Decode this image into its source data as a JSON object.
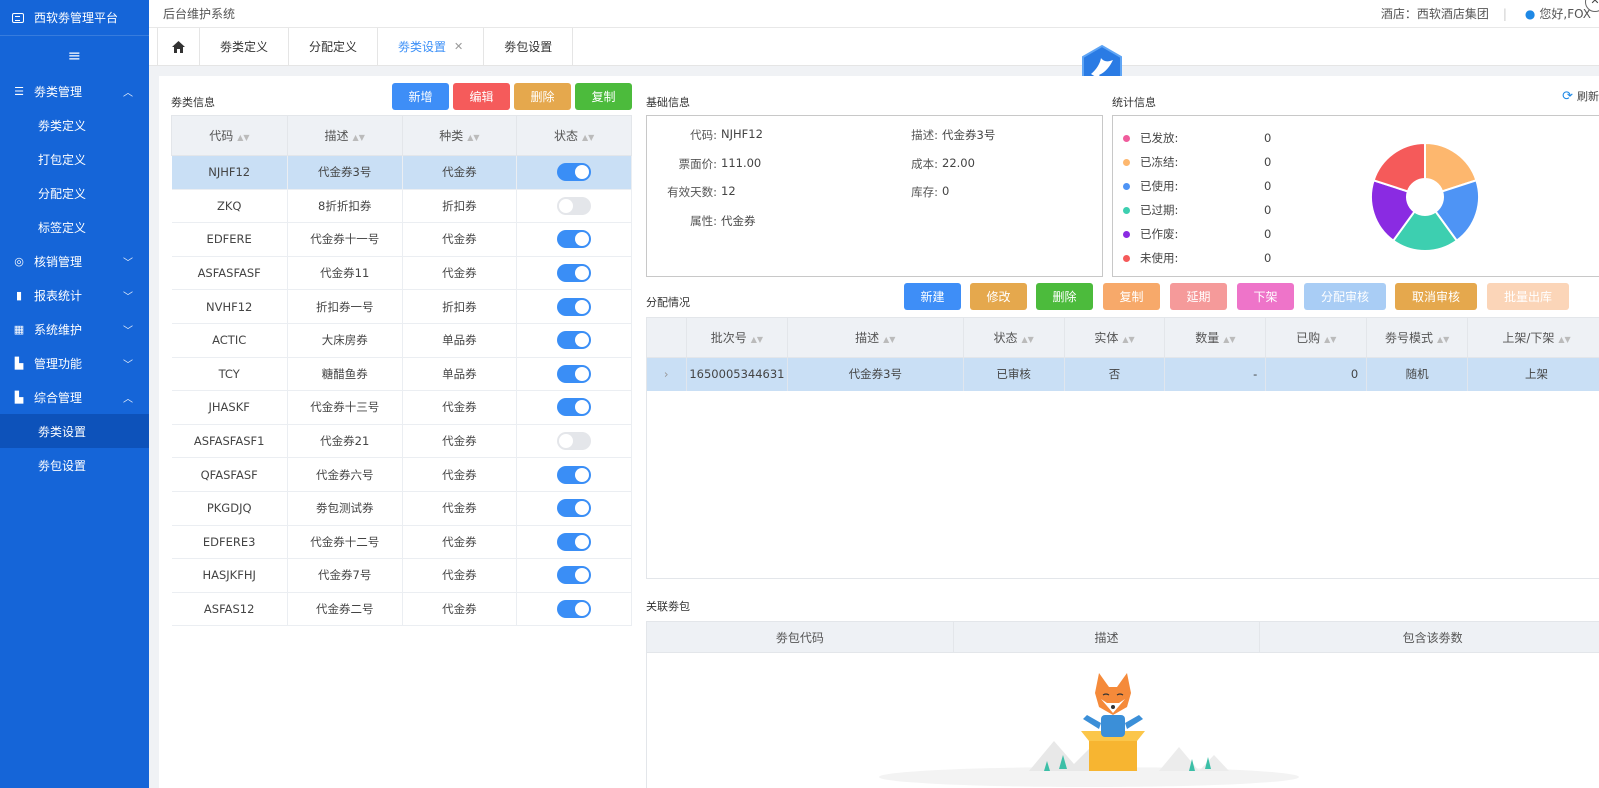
{
  "app": {
    "brand": "西软劵管理平台",
    "system_title": "后台维护系统",
    "hotel": "酒店：西软酒店集团",
    "separator": "|",
    "user": "您好,FOX"
  },
  "sidebar": {
    "collapse_icon": "≡",
    "menus": [
      {
        "label": "劵类管理",
        "icon": "list-icon",
        "expanded": true,
        "children": [
          "劵类定义",
          "打包定义",
          "分配定义",
          "标签定义"
        ]
      },
      {
        "label": "核销管理",
        "icon": "check-icon",
        "expanded": false,
        "children": []
      },
      {
        "label": "报表统计",
        "icon": "chart-icon",
        "expanded": false,
        "children": []
      },
      {
        "label": "系统维护",
        "icon": "grid-icon",
        "expanded": false,
        "children": []
      },
      {
        "label": "管理功能",
        "icon": "manage-icon",
        "expanded": false,
        "children": []
      },
      {
        "label": "综合管理",
        "icon": "manage-icon",
        "expanded": true,
        "children": [
          "劵类设置",
          "劵包设置"
        ]
      }
    ],
    "active_item": "劵类设置"
  },
  "tabs": [
    {
      "label": "劵类定义",
      "active": false
    },
    {
      "label": "分配定义",
      "active": false
    },
    {
      "label": "劵类设置",
      "active": true
    },
    {
      "label": "劵包设置",
      "active": false
    }
  ],
  "coupon_info": {
    "title": "劵类信息",
    "buttons": {
      "add": "新增",
      "edit": "编辑",
      "delete": "删除",
      "copy": "复制"
    },
    "columns": [
      "代码",
      "描述",
      "种类",
      "状态"
    ],
    "rows": [
      {
        "code": "NJHF12",
        "desc": "代金券3号",
        "kind": "代金券",
        "status": true,
        "selected": true
      },
      {
        "code": "ZKQ",
        "desc": "8折折扣券",
        "kind": "折扣券",
        "status": false
      },
      {
        "code": "EDFERE",
        "desc": "代金券十一号",
        "kind": "代金券",
        "status": true
      },
      {
        "code": "ASFASFASF",
        "desc": "代金券11",
        "kind": "代金券",
        "status": true
      },
      {
        "code": "NVHF12",
        "desc": "折扣券一号",
        "kind": "折扣券",
        "status": true
      },
      {
        "code": "ACTIC",
        "desc": "大床房券",
        "kind": "单品券",
        "status": true
      },
      {
        "code": "TCY",
        "desc": "糖醋鱼券",
        "kind": "单品券",
        "status": true
      },
      {
        "code": "JHASKF",
        "desc": "代金券十三号",
        "kind": "代金券",
        "status": true
      },
      {
        "code": "ASFASFASF1",
        "desc": "代金券21",
        "kind": "代金券",
        "status": false
      },
      {
        "code": "QFASFASF",
        "desc": "代金券六号",
        "kind": "代金券",
        "status": true
      },
      {
        "code": "PKGDJQ",
        "desc": "劵包测试券",
        "kind": "代金券",
        "status": true
      },
      {
        "code": "EDFERE3",
        "desc": "代金券十二号",
        "kind": "代金券",
        "status": true
      },
      {
        "code": "HASJKFHJ",
        "desc": "代金券7号",
        "kind": "代金券",
        "status": true
      },
      {
        "code": "ASFAS12",
        "desc": "代金券二号",
        "kind": "代金券",
        "status": true
      }
    ]
  },
  "basic_info": {
    "title": "基础信息",
    "fields": [
      {
        "k": "代码:",
        "v": "NJHF12"
      },
      {
        "k": "描述:",
        "v": "代金券3号"
      },
      {
        "k": "票面价:",
        "v": "111.00"
      },
      {
        "k": "成本:",
        "v": "22.00"
      },
      {
        "k": "有效天数:",
        "v": "12"
      },
      {
        "k": "库存:",
        "v": "0"
      },
      {
        "k": "属性:",
        "v": "代金券"
      }
    ]
  },
  "stats": {
    "title": "统计信息",
    "refresh": "刷新",
    "items": [
      {
        "label": "已发放:",
        "value": "0",
        "color": "#f05c9c"
      },
      {
        "label": "已冻结:",
        "value": "0",
        "color": "#fdb76e"
      },
      {
        "label": "已使用:",
        "value": "0",
        "color": "#4e94f5"
      },
      {
        "label": "已过期:",
        "value": "0",
        "color": "#3dcfb0"
      },
      {
        "label": "已作废:",
        "value": "0",
        "color": "#8a2be2"
      },
      {
        "label": "未使用:",
        "value": "0",
        "color": "#f55a5a"
      }
    ]
  },
  "distribution": {
    "title": "分配情况",
    "buttons": [
      {
        "label": "新建",
        "color": "#3e8ef7"
      },
      {
        "label": "修改",
        "color": "#e5a84d"
      },
      {
        "label": "删除",
        "color": "#4cbb3c"
      },
      {
        "label": "复制",
        "color": "#f7a96a"
      },
      {
        "label": "延期",
        "color": "#f59a9a"
      },
      {
        "label": "下架",
        "color": "#ee74c9"
      },
      {
        "label": "分配审核",
        "color": "#a9cdf5"
      },
      {
        "label": "取消审核",
        "color": "#e5a84d"
      },
      {
        "label": "批量出库",
        "color": "#fbd5b8"
      }
    ],
    "columns": [
      "批次号",
      "描述",
      "状态",
      "实体",
      "数量",
      "已购",
      "劵号模式",
      "上架/下架"
    ],
    "rows": [
      {
        "batch": "1650005344631",
        "desc": "代金券3号",
        "status": "已审核",
        "entity": "否",
        "qty": "-",
        "bought": "0",
        "mode": "随机",
        "shelf": "上架"
      }
    ]
  },
  "packages": {
    "title": "关联劵包",
    "columns": [
      "劵包代码",
      "描述",
      "包含该劵数"
    ]
  }
}
